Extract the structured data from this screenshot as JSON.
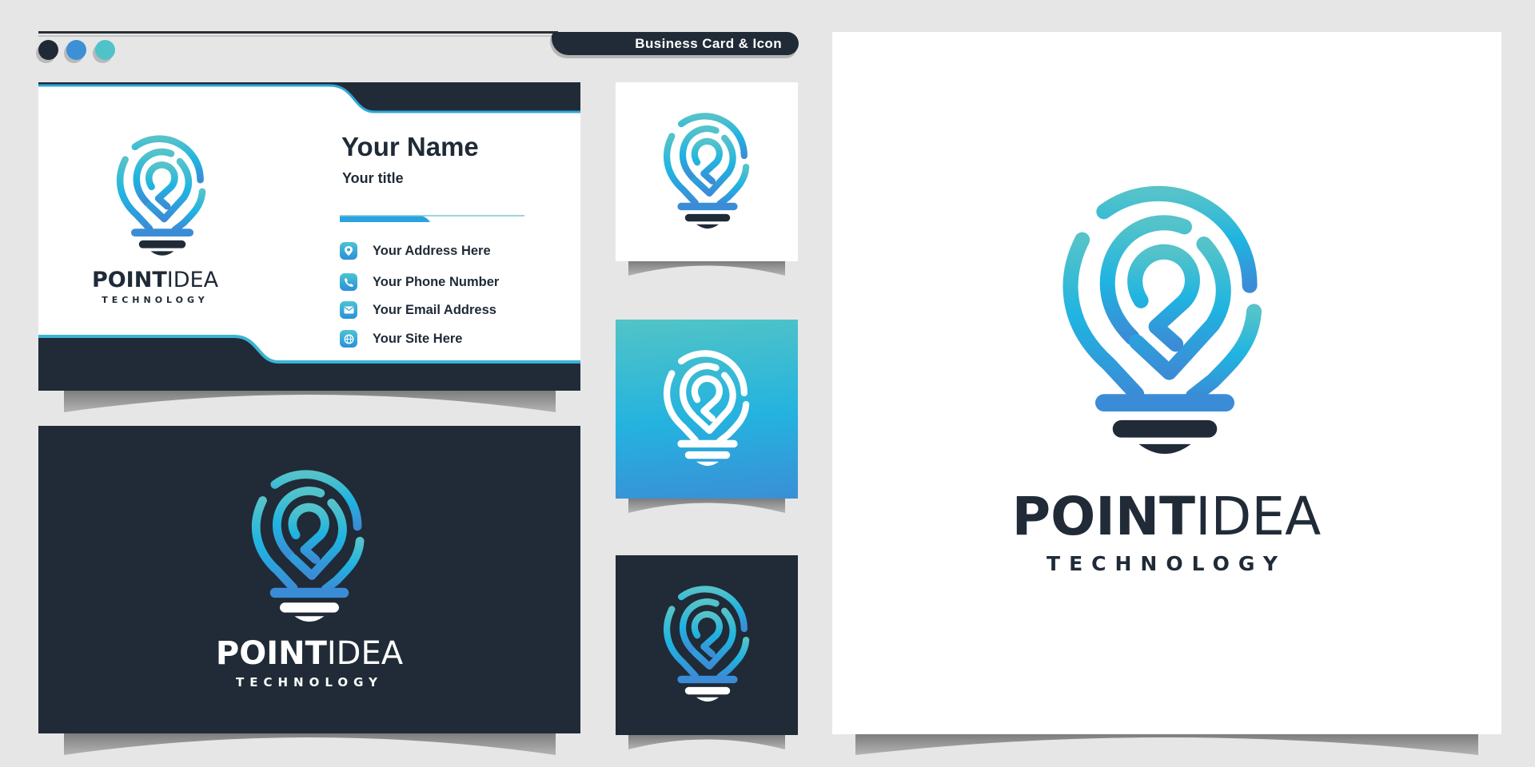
{
  "header": {
    "title": "Business Card & Icon",
    "color_dots": [
      {
        "name": "dark-navy",
        "color": "#1f2a36"
      },
      {
        "name": "blue",
        "color": "#3d8fd6"
      },
      {
        "name": "teal",
        "color": "#4fc3c8"
      }
    ]
  },
  "brand": {
    "name_bold": "POINT",
    "name_light": "IDEA",
    "tagline": "TECHNOLOGY",
    "colors": {
      "navy": "#202b37",
      "teal": "#52c4c6",
      "cyan": "#1fb3e0",
      "blue": "#3a8fd6",
      "background": "#e6e6e6"
    }
  },
  "business_card": {
    "name": "Your Name",
    "title": "Your title",
    "contacts": [
      {
        "icon": "map-pin-icon",
        "label": "Your Address Here"
      },
      {
        "icon": "phone-icon",
        "label": "Your Phone Number"
      },
      {
        "icon": "mail-icon",
        "label": "Your Email Address"
      },
      {
        "icon": "globe-icon",
        "label": "Your Site Here"
      }
    ]
  },
  "variants": [
    {
      "name": "business-card-front",
      "background": "white"
    },
    {
      "name": "logo-on-dark-card",
      "background": "navy"
    },
    {
      "name": "icon-on-white",
      "background": "white"
    },
    {
      "name": "icon-on-gradient",
      "background": "gradient"
    },
    {
      "name": "icon-on-dark",
      "background": "navy"
    },
    {
      "name": "primary-logo",
      "background": "white"
    }
  ]
}
